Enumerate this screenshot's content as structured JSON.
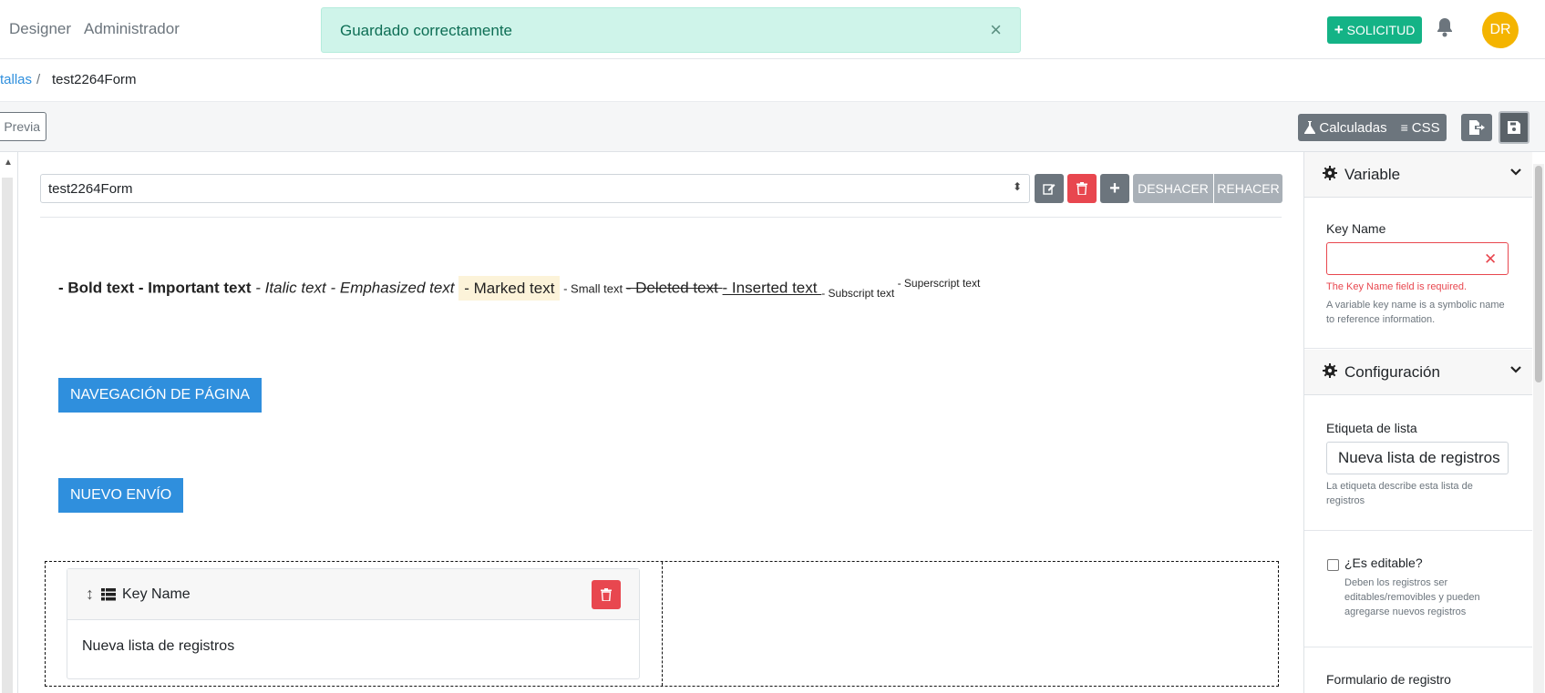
{
  "nav": {
    "designer": "Designer",
    "admin": "Administrador"
  },
  "toast": {
    "message": "Guardado correctamente",
    "close": "×"
  },
  "header": {
    "solicitud_label": "SOLICITUD",
    "avatar_initials": "DR"
  },
  "breadcrumb": {
    "parent": "tallas",
    "separator": "/",
    "current": "test2264Form"
  },
  "toolbar": {
    "preview_label": "Previa",
    "calculated_label": "Calculadas",
    "css_label": "CSS"
  },
  "editor": {
    "page_select": "test2264Form",
    "undo_label": "DESHACER",
    "redo_label": "REHACER",
    "rich_text": {
      "bold": "- Bold text",
      "important": " - Important text",
      "italic": " - Italic text",
      "emphasized": " - Emphasized text ",
      "marked": "- Marked text",
      "small": " - Small text ",
      "deleted": "- Deleted text ",
      "inserted": "- Inserted text ",
      "subscript": "- Subscript text",
      "superscript": " - Superscript text"
    },
    "nav_button": "NAVEGACIÓN DE PÁGINA",
    "submit_button": "NUEVO ENVÍO",
    "record_list": {
      "title": "Key Name",
      "body": "Nueva lista de registros"
    }
  },
  "inspector": {
    "variable_section": "Variable",
    "key_name_label": "Key Name",
    "key_name_value": "",
    "key_name_error": "The Key Name field is required.",
    "key_name_help": "A variable key name is a symbolic name to reference information.",
    "config_section": "Configuración",
    "list_label_label": "Etiqueta de lista",
    "list_label_value": "Nueva lista de registros",
    "list_label_help": "La etiqueta describe esta lista de registros",
    "editable_label": "¿Es editable?",
    "editable_help": "Deben los registros ser editables/removibles y pueden agregarse nuevos registros",
    "record_form_label": "Formulario de registro"
  },
  "colors": {
    "success": "#14b386",
    "primary": "#2f8fdd",
    "danger": "#e8474f",
    "secondary": "#6c757d",
    "avatar": "#f4b400"
  }
}
